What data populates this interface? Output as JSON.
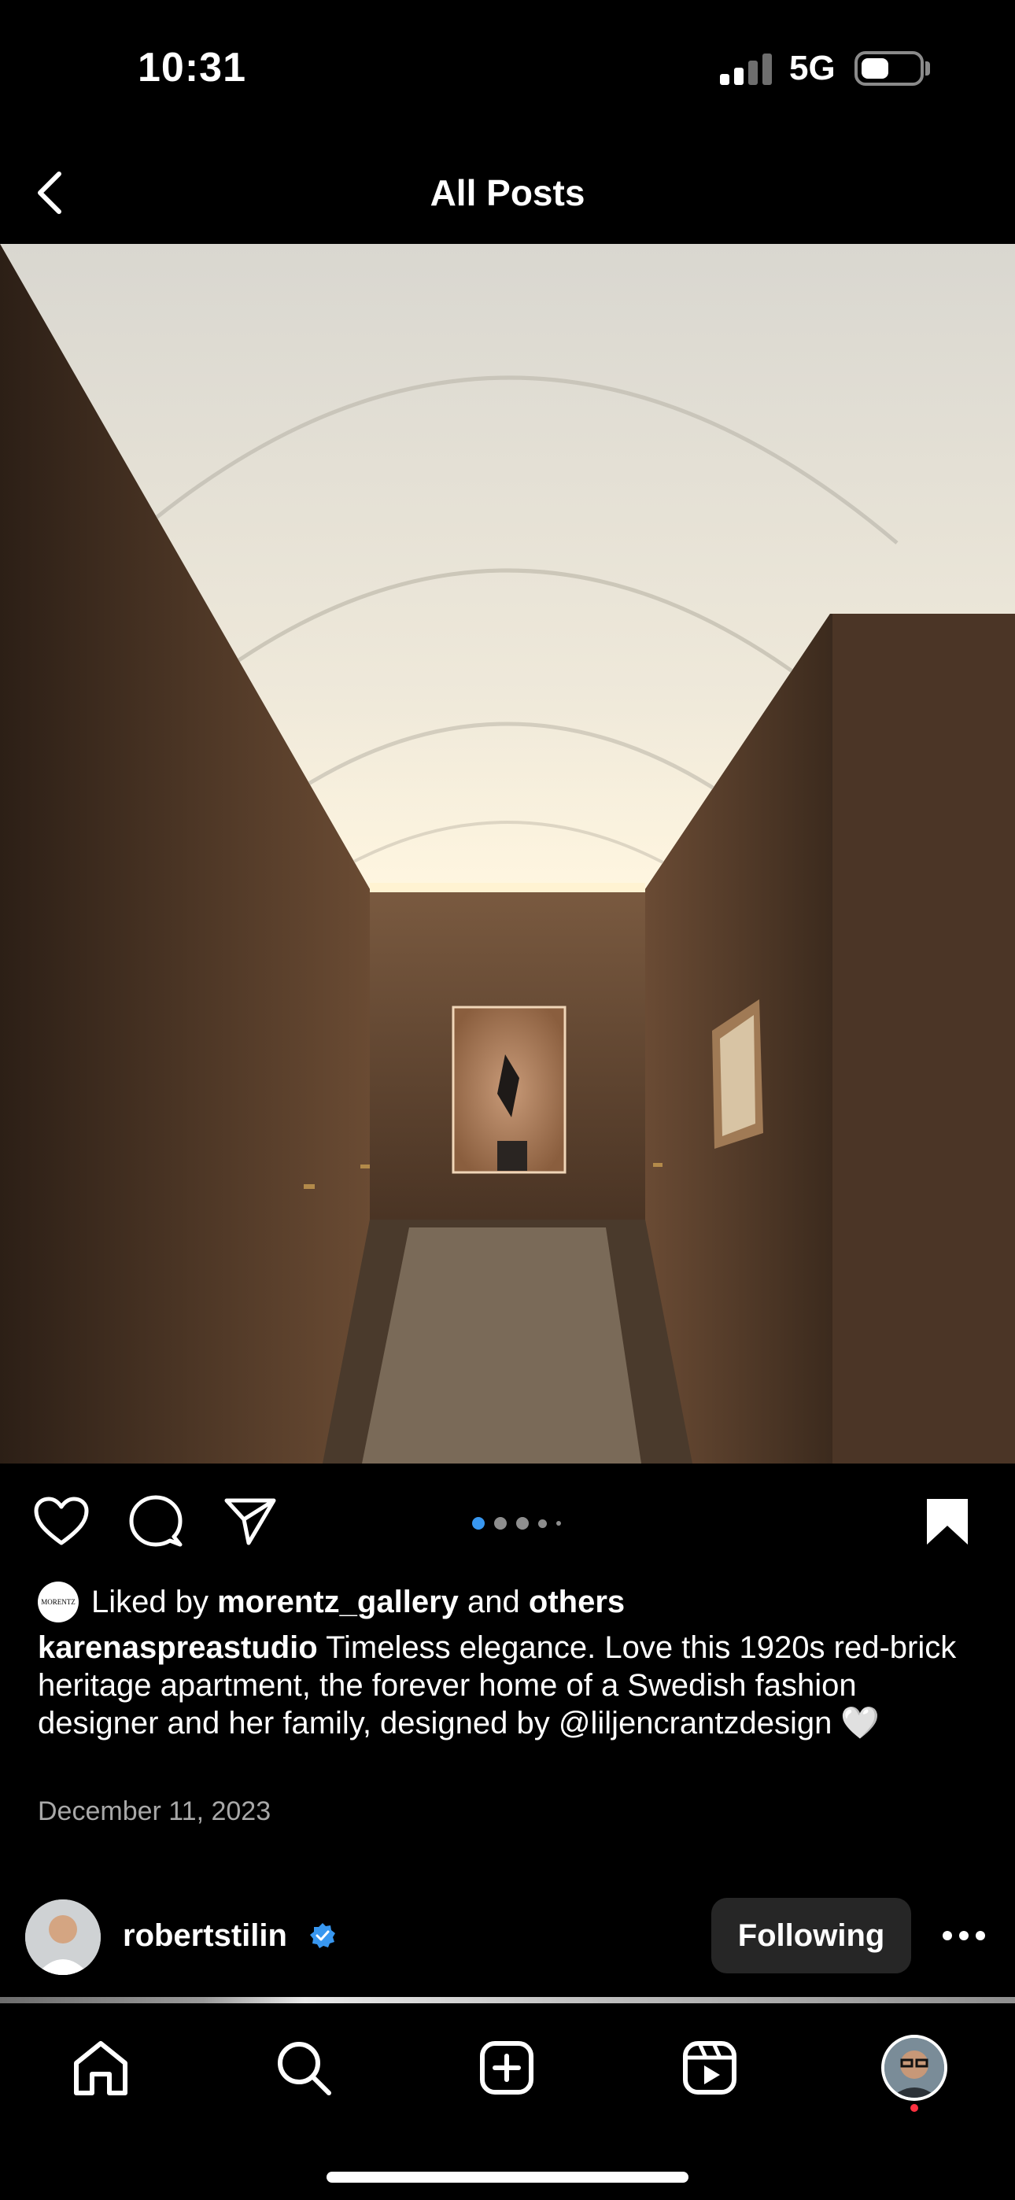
{
  "status_bar": {
    "time": "10:31",
    "network": "5G",
    "signal_bars_active": 2,
    "signal_bars_total": 4,
    "battery_level": 0.45
  },
  "header": {
    "title": "All Posts",
    "back_icon": "chevron-left-icon"
  },
  "post": {
    "carousel": {
      "total": 5,
      "active_index": 0
    },
    "actions": {
      "like_icon": "heart-icon",
      "comment_icon": "comment-bubble-icon",
      "share_icon": "paper-plane-icon",
      "save_icon": "bookmark-icon"
    },
    "likes": {
      "avatar_text": "MORENTZ",
      "prefix": "Liked by",
      "user": "morentz_gallery",
      "connector": "and",
      "others": "others"
    },
    "caption": {
      "username": "karenaspreastudio",
      "text": "Timeless elegance. Love this 1920s red-brick heritage apartment, the forever home of a Swedish fashion designer and her family, designed by @liljencrantzdesign 🤍"
    },
    "date": "December 11, 2023"
  },
  "next_post": {
    "username": "robertstilin",
    "verified": true,
    "follow_label": "Following",
    "more_icon": "ellipsis-icon"
  },
  "tab_bar": {
    "items": [
      {
        "name": "home",
        "icon": "home-icon"
      },
      {
        "name": "search",
        "icon": "search-icon"
      },
      {
        "name": "create",
        "icon": "plus-square-icon"
      },
      {
        "name": "reels",
        "icon": "reels-icon"
      },
      {
        "name": "profile",
        "icon": "profile-avatar"
      }
    ],
    "profile_has_notification": true
  },
  "colors": {
    "background": "#000000",
    "accent_blue": "#3897f0",
    "notification": "#ff3040",
    "muted_text": "#a8a8a8",
    "button_bg": "#262626"
  }
}
